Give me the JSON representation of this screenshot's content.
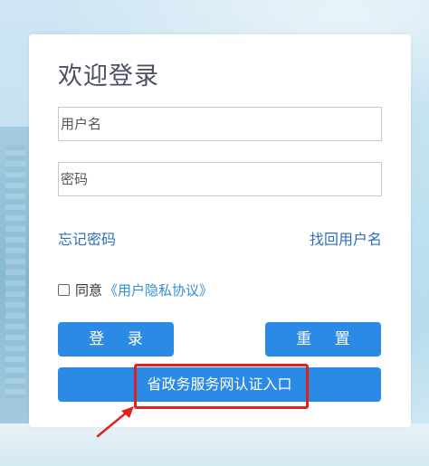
{
  "login": {
    "title": "欢迎登录",
    "username_placeholder": "用户名",
    "password_placeholder": "密码",
    "forgot_password": "忘记密码",
    "recover_username": "找回用户名",
    "agree_prefix": "同意",
    "privacy_link": "《用户隐私协议》",
    "login_button": "登 录",
    "reset_button": "重 置",
    "gov_entry_button": "省政务服务网认证入口"
  },
  "colors": {
    "primary_button": "#2b8ae6",
    "link": "#2f6fb8",
    "highlight": "#e0221c"
  }
}
